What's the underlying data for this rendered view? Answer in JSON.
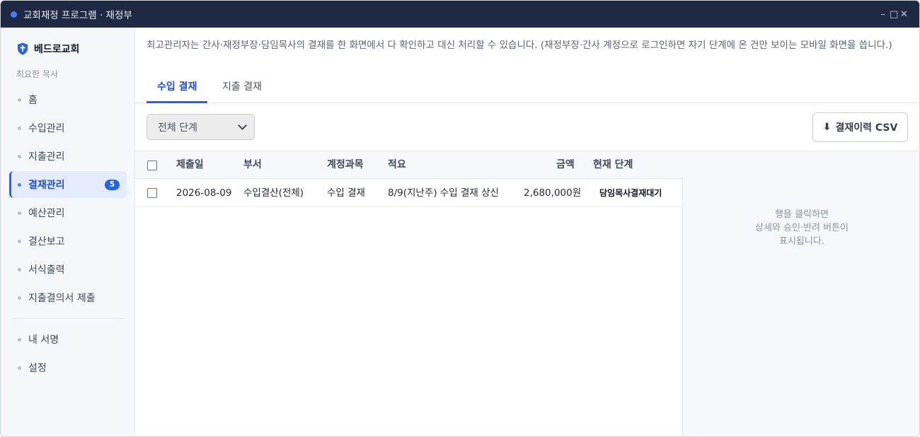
{
  "window": {
    "title": "교회재정 프로그램 · 재정부",
    "controls": {
      "minimize": "–",
      "maximize": "□",
      "close": "✕"
    }
  },
  "sidebar": {
    "brand": "베드로교회",
    "user": "최요한 목사",
    "items": [
      {
        "label": "홈"
      },
      {
        "label": "수입관리"
      },
      {
        "label": "지출관리"
      },
      {
        "label": "결재관리",
        "badge": "5",
        "active": true
      },
      {
        "label": "예산관리"
      },
      {
        "label": "결산보고"
      },
      {
        "label": "서식출력"
      },
      {
        "label": "지출결의서 제출"
      }
    ],
    "bottom_items": [
      {
        "label": "내 서명"
      },
      {
        "label": "설정"
      }
    ]
  },
  "main": {
    "notice": "최고관리자는 간사·재정부장·담임목사의 결재를 한 화면에서 다 확인하고 대신 처리할 수 있습니다. (재정부장·간사 계정으로 로그인하면 자기 단계에 온 건만 보이는 모바일 화면을 씁니다.)",
    "tabs": [
      {
        "label": "수입 결재",
        "active": true
      },
      {
        "label": "지출 결재"
      }
    ],
    "filter": {
      "selected": "전체 단계"
    },
    "csv_button": "결재이력 CSV",
    "table": {
      "headers": [
        "제출일",
        "부서",
        "계정과목",
        "적요",
        "금액",
        "현재 단계"
      ],
      "rows": [
        {
          "date": "2026-08-09",
          "dept": "수입결산(전체)",
          "account": "수입 결재",
          "summary": "8/9(지난주) 수입 결재 상신",
          "amount": "2,680,000원",
          "stage": "담임목사결재대기"
        }
      ]
    },
    "detail_placeholder": [
      "행을 클릭하면",
      "상세와 승인·반려 버튼이",
      "표시됩니다."
    ]
  },
  "colors": {
    "titlebar": "#1e2a44",
    "accent": "#2563eb",
    "sidebar_bg": "#f5f7fa"
  }
}
